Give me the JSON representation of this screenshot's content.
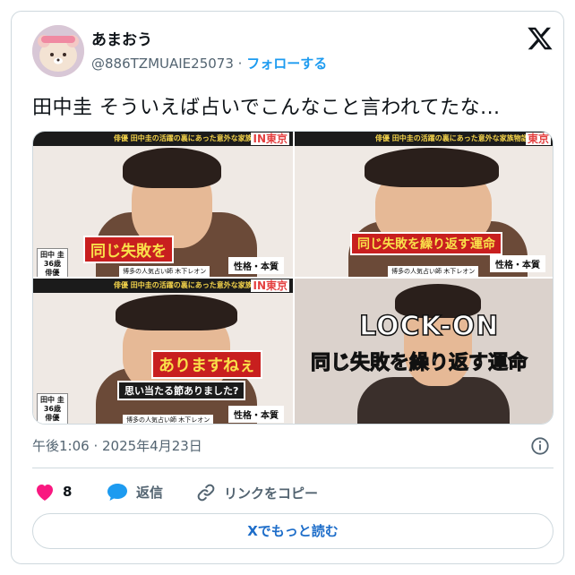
{
  "user": {
    "display_name": "あまおう",
    "handle": "@886TZMUAIE25073",
    "separator": "·",
    "follow_label": "フォローする"
  },
  "tweet": {
    "text": "田中圭 そういえば占いでこんなこと言われてたな..."
  },
  "media": {
    "panel1": {
      "caption": "同じ失敗を",
      "name_lines": [
        "田中 圭",
        "36歳",
        "俳優"
      ],
      "tag": "性格・本質",
      "subline": "博多の人気占い師 木下レオン",
      "topbar": "俳優 田中圭の活躍の裏にあった意外な家族物語とは!?",
      "location": "IN東京"
    },
    "panel2": {
      "caption": "同じ失敗を繰り返す運命",
      "tag": "性格・本質",
      "subline": "博多の人気占い師 木下レオン",
      "topbar": "俳優 田中圭の活躍の裏にあった意外な家族物語とは!?",
      "location": "東京"
    },
    "panel3": {
      "caption": "ありますねぇ",
      "question": "思い当たる節ありました?",
      "name_lines": [
        "田中 圭",
        "36歳",
        "俳優"
      ],
      "tag": "性格・本質",
      "subline": "博多の人気占い師 木下レオン",
      "topbar": "俳優 田中圭の活躍の裏にあった意外な家族物語とは!?",
      "location": "IN東京"
    },
    "panel4": {
      "title": "LOCK-ON",
      "subtitle": "同じ失敗を繰り返す運命"
    }
  },
  "meta": {
    "timestamp": "午後1:06 · 2025年4月23日"
  },
  "actions": {
    "like_count": "8",
    "reply_label": "返信",
    "copy_link_label": "リンクをコピー"
  },
  "read_more_label": "Xでもっと読む",
  "colors": {
    "accent": "#1d9bf0",
    "heart": "#f91880",
    "reply": "#1d9bf0",
    "text_secondary": "#536471",
    "caption_red": "#d12f2f"
  }
}
